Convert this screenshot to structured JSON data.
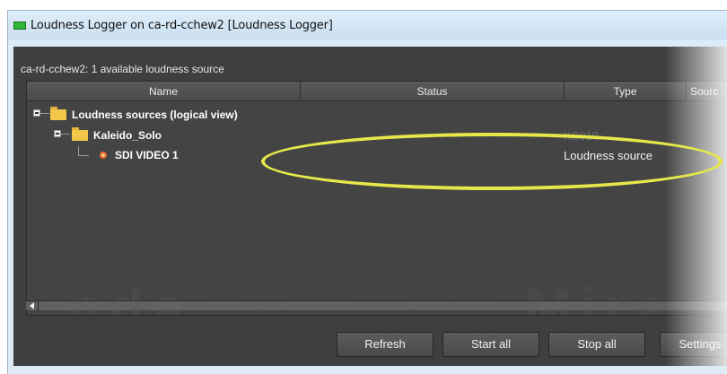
{
  "window": {
    "title": "Loudness Logger on ca-rd-cchew2 [Loudness Logger]"
  },
  "panel": {
    "subtitle": "ca-rd-cchew2: 1 available loudness source",
    "watermark_left": "nda",
    "watermark_right": "Mira"
  },
  "table": {
    "columns": [
      "Name",
      "Status",
      "Type",
      "Sourc"
    ]
  },
  "tree": {
    "root": {
      "label": "Loudness sources (logical view)"
    },
    "device": {
      "label": "Kaleido_Solo",
      "type": "KS910"
    },
    "source": {
      "label": "SDI VIDEO 1",
      "type": "Loudness source"
    }
  },
  "buttons": {
    "refresh": "Refresh",
    "start_all": "Start all",
    "stop_all": "Stop all",
    "settings": "Settings"
  },
  "colors": {
    "highlight": "#e6e84a",
    "title_icon": "#2fb83a",
    "folder": "#f3c84a",
    "source_icon": "#e8692a"
  },
  "icons": [
    "app-icon",
    "expand-icon",
    "folder-icon",
    "loudness-source-icon",
    "scroll-left-arrow-icon"
  ]
}
